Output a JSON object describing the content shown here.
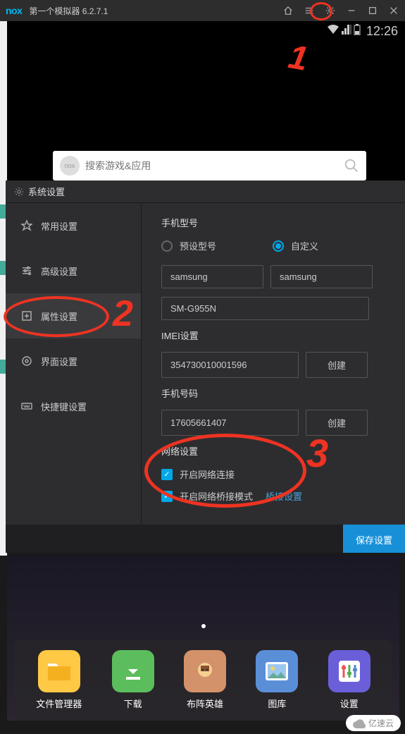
{
  "titlebar": {
    "logo": "nox",
    "title": "第一个模拟器 6.2.7.1"
  },
  "statusbar": {
    "time": "12:26"
  },
  "search": {
    "placeholder": "搜索游戏&应用",
    "logo_text": "nox"
  },
  "settings": {
    "dialog_title": "系统设置",
    "sidebar": {
      "general": "常用设置",
      "advanced": "高级设置",
      "property": "属性设置",
      "interface": "界面设置",
      "shortcut": "快捷键设置"
    },
    "content": {
      "phone_model_label": "手机型号",
      "radio_preset": "预设型号",
      "radio_custom": "自定义",
      "manufacturer": "samsung",
      "brand": "samsung",
      "model": "SM-G955N",
      "imei_label": "IMEI设置",
      "imei_value": "354730010001596",
      "phone_number_label": "手机号码",
      "phone_number_value": "17605661407",
      "network_label": "网络设置",
      "checkbox_network": "开启网络连接",
      "checkbox_bridge": "开启网络桥接模式",
      "bridge_link": "桥接设置",
      "btn_create": "创建",
      "btn_save": "保存设置"
    }
  },
  "apps": {
    "file_manager": "文件管理器",
    "download": "下载",
    "game": "布阵英雄",
    "gallery": "图库",
    "settings": "设置"
  },
  "watermark": "亿速云"
}
